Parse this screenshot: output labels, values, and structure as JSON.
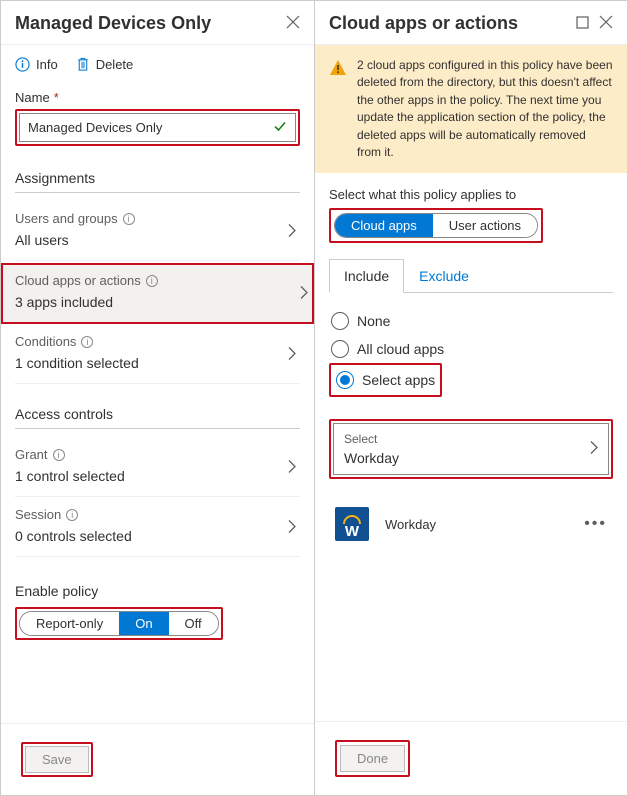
{
  "left": {
    "title": "Managed Devices Only",
    "toolbar": {
      "info": "Info",
      "delete": "Delete"
    },
    "name_label": "Name",
    "name_value": "Managed Devices Only",
    "sections": {
      "assignments": {
        "title": "Assignments",
        "users": {
          "label": "Users and groups",
          "value": "All users"
        },
        "apps": {
          "label": "Cloud apps or actions",
          "value": "3 apps included"
        },
        "conditions": {
          "label": "Conditions",
          "value": "1 condition selected"
        }
      },
      "access": {
        "title": "Access controls",
        "grant": {
          "label": "Grant",
          "value": "1 control selected"
        },
        "session": {
          "label": "Session",
          "value": "0 controls selected"
        }
      }
    },
    "enable": {
      "title": "Enable policy",
      "options": [
        "Report-only",
        "On",
        "Off"
      ],
      "selected": "On"
    },
    "save": "Save"
  },
  "right": {
    "title": "Cloud apps or actions",
    "warning": "2 cloud apps configured in this policy have been deleted from the directory, but this doesn't affect the other apps in the policy. The next time you update the application section of the policy, the deleted apps will be automatically removed from it.",
    "applies_label": "Select what this policy applies to",
    "applies_options": [
      "Cloud apps",
      "User actions"
    ],
    "applies_selected": "Cloud apps",
    "tabs": [
      "Include",
      "Exclude"
    ],
    "tab_selected": "Include",
    "radios": [
      "None",
      "All cloud apps",
      "Select apps"
    ],
    "radio_selected": "Select apps",
    "select": {
      "label": "Select",
      "value": "Workday"
    },
    "app": {
      "name": "Workday"
    },
    "done": "Done"
  }
}
